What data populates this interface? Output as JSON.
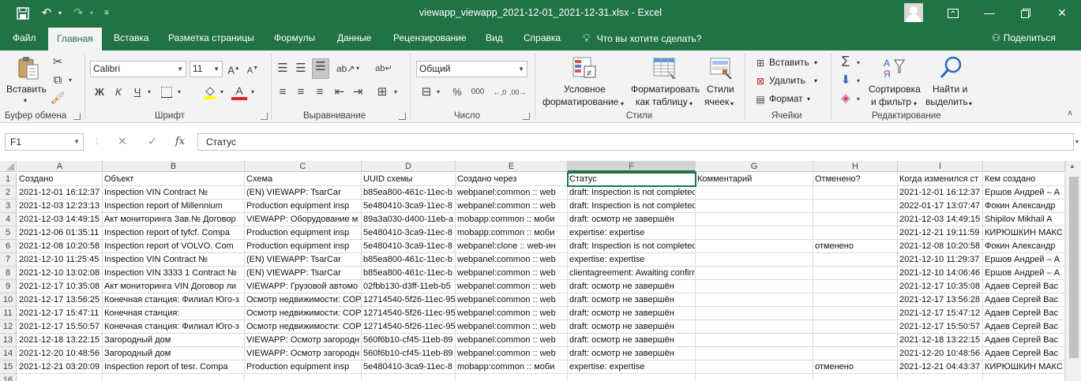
{
  "window": {
    "title": "viewapp_viewapp_2021-12-01_2021-12-31.xlsx  -  Excel",
    "save_icon": "save-icon",
    "undo_icon": "undo-icon",
    "redo_icon": "redo-icon"
  },
  "tabs": [
    "Файл",
    "Главная",
    "Вставка",
    "Разметка страницы",
    "Формулы",
    "Данные",
    "Рецензирование",
    "Вид",
    "Справка"
  ],
  "active_tab": "Главная",
  "tell_me": "Что вы хотите сделать?",
  "share": "Поделиться",
  "ribbon": {
    "clipboard": {
      "label": "Буфер обмена",
      "paste": "Вставить"
    },
    "font": {
      "label": "Шрифт",
      "family": "Calibri",
      "size": "11",
      "bold": "Ж",
      "italic": "К",
      "underline": "Ч",
      "font_color_glyph": "А"
    },
    "alignment": {
      "label": "Выравнивание"
    },
    "number": {
      "label": "Число",
      "format": "Общий",
      "percent": "%",
      "thousands": "000"
    },
    "styles": {
      "label": "Стили",
      "conditional": "Условное",
      "conditional2": "форматирование",
      "as_table": "Форматировать",
      "as_table2": "как таблицу",
      "cell_styles": "Стили",
      "cell_styles2": "ячеек"
    },
    "cells": {
      "label": "Ячейки",
      "insert": "Вставить",
      "delete": "Удалить",
      "format": "Формат"
    },
    "editing": {
      "label": "Редактирование",
      "sort": "Сортировка",
      "sort2": "и фильтр",
      "find": "Найти и",
      "find2": "выделить"
    }
  },
  "formula_bar": {
    "name_box": "F1",
    "fx": "fx",
    "value": "Статус"
  },
  "columns": [
    "A",
    "B",
    "C",
    "D",
    "E",
    "F",
    "G",
    "H",
    "I"
  ],
  "selected_column": "F",
  "rows": [
    [
      "Создано",
      "Объект",
      "Схема",
      "UUID схемы",
      "Создано через",
      "Статус",
      "Комментарий",
      "Отменено?",
      "Когда изменился ст",
      "Кем создано"
    ],
    [
      "2021-12-01 16:12:37",
      "Inspection VIN Contract №",
      "(EN) VIEWAPP: TsarCar",
      "b85ea800-461c-11ec-b",
      "webpanel:common :: web",
      "draft: Inspection is not completed",
      "",
      "",
      "2021-12-01 16:12:37",
      "Ершов Андрей – А"
    ],
    [
      "2021-12-03 12:23:13",
      "Inspection report of Millennium",
      "Production equipment insp",
      "5e480410-3ca9-11ec-8",
      "webpanel:common :: web",
      "draft: Inspection is not completed",
      "",
      "",
      "2022-01-17 13:07:47",
      "Фокин Александр"
    ],
    [
      "2021-12-03 14:49:15",
      "Акт мониторинга Зав.№ Договор",
      "VIEWAPP: Оборудование м",
      "89a3a030-d400-11eb-a",
      "mobapp:common :: моби",
      "draft: осмотр не завершён",
      "",
      "",
      "2021-12-03 14:49:15",
      "Shipilov Mikhail A"
    ],
    [
      "2021-12-06 01:35:11",
      "Inspection report of tyfcf. Compa",
      "Production equipment insp",
      "5e480410-3ca9-11ec-8",
      "mobapp:common :: моби",
      "expertise: expertise",
      "",
      "",
      "2021-12-21 19:11:59",
      "КИРЮШКИН МАКС"
    ],
    [
      "2021-12-08 10:20:58",
      "Inspection report of VOLVO. Com",
      "Production equipment insp",
      "5e480410-3ca9-11ec-8",
      "webpanel:clone :: web-ин",
      "draft: Inspection is not completed",
      "",
      "отменено",
      "2021-12-08 10:20:58",
      "Фокин Александр"
    ],
    [
      "2021-12-10 11:25:45",
      "Inspection VIN Contract №",
      "(EN) VIEWAPP: TsarCar",
      "b85ea800-461c-11ec-b",
      "webpanel:common :: web",
      "expertise: expertise",
      "",
      "",
      "2021-12-10 11:29:37",
      "Ершов Андрей – А"
    ],
    [
      "2021-12-10 13:02:08",
      "Inspection VIN 3333 1 Contract №",
      "(EN) VIEWAPP: TsarCar",
      "b85ea800-461c-11ec-b",
      "webpanel:common :: web",
      "clientagreement: Awaiting confirmation",
      "",
      "",
      "2021-12-10 14:06:46",
      "Ершов Андрей – А"
    ],
    [
      "2021-12-17 10:35:08",
      "Акт мониторинга VIN Договор ли",
      "VIEWAPP: Грузовой автомо",
      "02fbb130-d3ff-11eb-b5",
      "webpanel:common :: web",
      "draft: осмотр не завершён",
      "",
      "",
      "2021-12-17 10:35:08",
      "Адаев Сергей Вас"
    ],
    [
      "2021-12-17 13:56:25",
      "Конечная станция: Филиал Юго-з",
      "Осмотр недвижимости: СОР",
      "12714540-5f26-11ec-95",
      "webpanel:common :: web",
      "draft: осмотр не завершён",
      "",
      "",
      "2021-12-17 13:56:28",
      "Адаев Сергей Вас"
    ],
    [
      "2021-12-17 15:47:11",
      "Конечная станция:",
      "Осмотр недвижимости: СОР",
      "12714540-5f26-11ec-95",
      "webpanel:common :: web",
      "draft: осмотр не завершён",
      "",
      "",
      "2021-12-17 15:47:12",
      "Адаев Сергей Вас"
    ],
    [
      "2021-12-17 15:50:57",
      "Конечная станция: Филиал Юго-з",
      "Осмотр недвижимости: СОР",
      "12714540-5f26-11ec-95",
      "webpanel:common :: web",
      "draft: осмотр не завершён",
      "",
      "",
      "2021-12-17 15:50:57",
      "Адаев Сергей Вас"
    ],
    [
      "2021-12-18 13:22:15",
      "Загородный дом",
      "VIEWAPP: Осмотр загородн",
      "560f6b10-cf45-11eb-89",
      "webpanel:common :: web",
      "draft: осмотр не завершён",
      "",
      "",
      "2021-12-18 13:22:15",
      "Адаев Сергей Вас"
    ],
    [
      "2021-12-20 10:48:56",
      "Загородный дом",
      "VIEWAPP: Осмотр загородн",
      "560f6b10-cf45-11eb-89",
      "webpanel:common :: web",
      "draft: осмотр не завершён",
      "",
      "",
      "2021-12-20 10:48:56",
      "Адаев Сергей Вас"
    ],
    [
      "2021-12-21 03:20:09",
      "Inspection report of tesr. Compa",
      "Production equipment insp",
      "5e480410-3ca9-11ec-8",
      "mobapp:common :: моби",
      "expertise: expertise",
      "",
      "отменено",
      "2021-12-21 04:43:37",
      "КИРЮШКИН МАКС"
    ]
  ],
  "row_numbers": [
    "1",
    "2",
    "3",
    "4",
    "5",
    "6",
    "7",
    "8",
    "9",
    "10",
    "11",
    "12",
    "13",
    "14",
    "15",
    "16"
  ]
}
